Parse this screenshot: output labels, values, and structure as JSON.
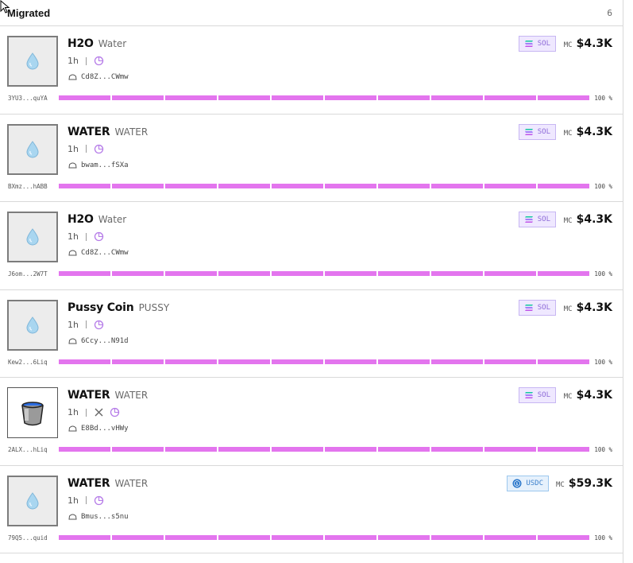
{
  "panel": {
    "title": "Migrated",
    "count": "6"
  },
  "colors": {
    "progress": "#e375ee",
    "sol_badge_bg": "#efe8ff",
    "sol_badge_text": "#8d6ad8",
    "usdc_badge_bg": "#e6f1fc",
    "usdc_badge_text": "#3f82cc"
  },
  "items": [
    {
      "name": "H2O",
      "ticker": "Water",
      "age": "1h",
      "dev": "Cd8Z...CWmw",
      "chain": "SOL",
      "mc_label": "MC",
      "mc": "$4.3K",
      "address": "3YU3...quYA",
      "progress_label": "100 %",
      "progress": 100,
      "thumb_icon": "water-drop-icon",
      "has_x_icon": false
    },
    {
      "name": "WATER",
      "ticker": "WATER",
      "age": "1h",
      "dev": "bwam...fSXa",
      "chain": "SOL",
      "mc_label": "MC",
      "mc": "$4.3K",
      "address": "BXmz...hABB",
      "progress_label": "100 %",
      "progress": 100,
      "thumb_icon": "water-drop-icon",
      "has_x_icon": false
    },
    {
      "name": "H2O",
      "ticker": "Water",
      "age": "1h",
      "dev": "Cd8Z...CWmw",
      "chain": "SOL",
      "mc_label": "MC",
      "mc": "$4.3K",
      "address": "J6om...2W7T",
      "progress_label": "100 %",
      "progress": 100,
      "thumb_icon": "water-drop-icon",
      "has_x_icon": false
    },
    {
      "name": "Pussy Coin",
      "ticker": "PUSSY",
      "age": "1h",
      "dev": "6Ccy...N91d",
      "chain": "SOL",
      "mc_label": "MC",
      "mc": "$4.3K",
      "address": "Kew2...6Liq",
      "progress_label": "100 %",
      "progress": 100,
      "thumb_icon": "water-drop-icon",
      "has_x_icon": false
    },
    {
      "name": "WATER",
      "ticker": "WATER",
      "age": "1h",
      "dev": "E8Bd...vHWy",
      "chain": "SOL",
      "mc_label": "MC",
      "mc": "$4.3K",
      "address": "2ALX...hLiq",
      "progress_label": "100 %",
      "progress": 100,
      "thumb_icon": "bucket-icon",
      "has_x_icon": true
    },
    {
      "name": "WATER",
      "ticker": "WATER",
      "age": "1h",
      "dev": "Bmus...s5nu",
      "chain": "USDC",
      "mc_label": "MC",
      "mc": "$59.3K",
      "address": "79Q5...quid",
      "progress_label": "100 %",
      "progress": 100,
      "thumb_icon": "water-drop-icon",
      "has_x_icon": false
    }
  ]
}
